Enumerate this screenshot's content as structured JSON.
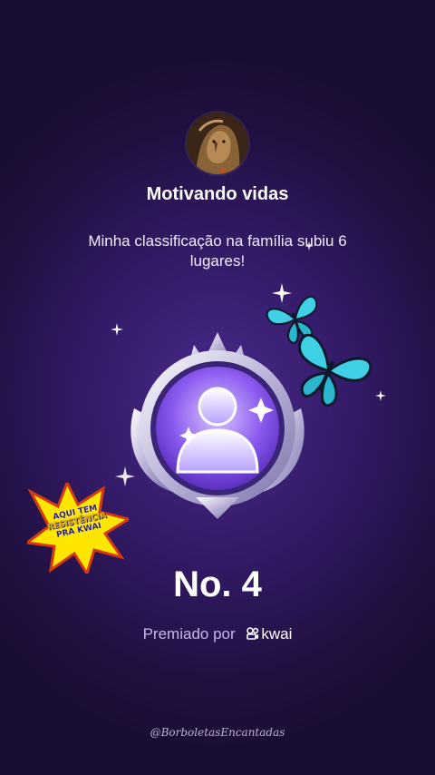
{
  "profile": {
    "name": "Motivando vidas",
    "message": "Minha classificação na família subiu 6 lugares!"
  },
  "ranking": {
    "label": "No. 4"
  },
  "award": {
    "prefix": "Premiado por",
    "brand": "kwai"
  },
  "sticker": {
    "line1": "AQUI TEM",
    "line2": "RESISTÊNCIA",
    "line3": "PRA KWAI"
  },
  "watermark": "@BorboletasEncantadas",
  "icons": {
    "avatar": "lion-avatar-icon",
    "badge": "person-medal-icon",
    "butterflies": "butterfly-icon",
    "brand": "kwai-logo-icon"
  },
  "colors": {
    "background": "#331a66",
    "award_text": "#c6b6e6",
    "butterfly": "#3fd0e6",
    "sticker": "#ffe600"
  }
}
